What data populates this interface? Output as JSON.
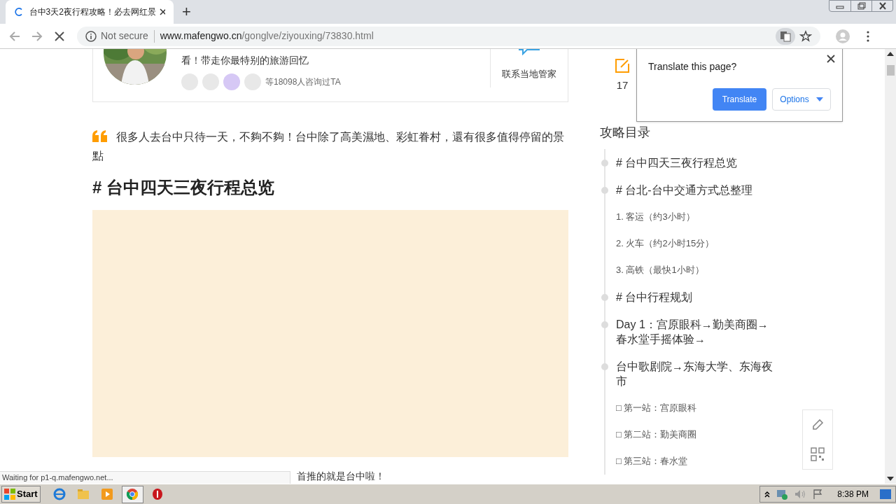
{
  "browser": {
    "tab": {
      "title": "台中3天2夜行程攻略！必去网红景",
      "loading": true
    },
    "new_tab": "+",
    "address": {
      "security": "Not secure",
      "domain": "www.mafengwo.cn",
      "path": "/gonglve/ziyouxing/73830.html"
    },
    "translate_popup": {
      "title": "Translate this page?",
      "translate_button": "Translate",
      "options_button": "Options"
    }
  },
  "expert_card": {
    "tagline": "看！带走你最特别的旅游回忆",
    "consult_count": "等18098人咨询过TA",
    "contact_label": "联系当地管家"
  },
  "article": {
    "intro": "很多人去台中只待一天，不夠不夠！台中除了高美濕地、彩虹眷村，還有很多值得停留的景點",
    "heading": "# 台中四天三夜行程总览",
    "trailing_text": "首推的就是台中啦！"
  },
  "sidebar": {
    "count": "17",
    "toc_title": "攻略目录",
    "toc": [
      {
        "kind": "section",
        "text": "# 台中四天三夜行程总览"
      },
      {
        "kind": "section",
        "text": " # 台北-台中交通方式总整理"
      },
      {
        "kind": "sub",
        "text": "1. 客运（约3小时）"
      },
      {
        "kind": "sub",
        "text": "2. 火车（约2小时15分）"
      },
      {
        "kind": "sub",
        "text": "3. 高铁（最快1小时）"
      },
      {
        "kind": "section",
        "text": "# 台中行程规划"
      },
      {
        "kind": "section",
        "text": "Day 1：宫原眼科→勤美商圈→春水堂手摇体验→"
      },
      {
        "kind": "section",
        "text": "台中歌剧院→东海大学、东海夜市"
      },
      {
        "kind": "sub",
        "text": "□ 第一站：宫原眼科"
      },
      {
        "kind": "sub",
        "text": "□ 第二站：勤美商圈"
      },
      {
        "kind": "sub",
        "text": "□ 第三站：春水堂"
      }
    ]
  },
  "status_text": "Waiting for p1-q.mafengwo.net...",
  "taskbar": {
    "start": "Start",
    "clock": "8:38 PM"
  }
}
